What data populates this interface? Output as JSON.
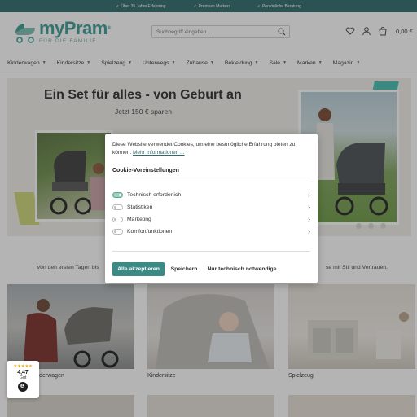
{
  "topbar": {
    "items": [
      "Über 35 Jahre Erfahrung",
      "Premium Marken",
      "Persönliche Beratung"
    ]
  },
  "header": {
    "logo_word": "myPram",
    "logo_reg": "®",
    "logo_sub": "FÜR DIE FAMILIE",
    "search_placeholder": "Suchbegriff eingeben ...",
    "cart_total": "0,00 €"
  },
  "nav": {
    "items": [
      "Kinderwagen",
      "Kindersitze",
      "Spielzeug",
      "Unterwegs",
      "Zuhause",
      "Bekleidung",
      "Sale",
      "Marken",
      "Magazin"
    ]
  },
  "hero": {
    "title": "Ein Set für alles - von Geburt an",
    "subtitle": "Jetzt 150 € sparen"
  },
  "intro": {
    "left": "Von den ersten Tagen bis",
    "right": "se mit Stil und Vertrauen."
  },
  "categories": [
    "Kinderwagen",
    "Kindersitze",
    "Spielzeug"
  ],
  "cookie": {
    "text": "Diese Website verwendet Cookies, um eine bestmögliche Erfahrung bieten zu können.",
    "link": "Mehr Informationen ...",
    "heading": "Cookie-Voreinstellungen",
    "options": [
      {
        "label": "Technisch erforderlich",
        "enabled": true
      },
      {
        "label": "Statistiken",
        "enabled": false
      },
      {
        "label": "Marketing",
        "enabled": false
      },
      {
        "label": "Komfortfunktionen",
        "enabled": false
      }
    ],
    "accept_all": "Alle akzeptieren",
    "save": "Speichern",
    "necessary_only": "Nur technisch notwendige"
  },
  "rating": {
    "stars": "★★★★★",
    "score": "4,47",
    "grade": "Gut"
  },
  "colors": {
    "brand": "#3a9a93",
    "topbar": "#2f6b6b",
    "accept_button": "#3b8a86"
  }
}
